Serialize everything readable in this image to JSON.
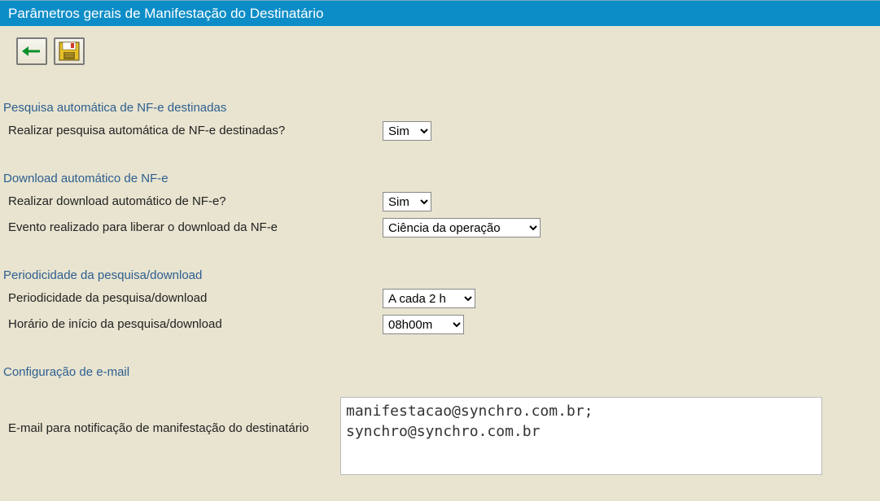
{
  "title": "Parâmetros gerais de Manifestação do Destinatário",
  "sections": {
    "pesquisa": {
      "title": "Pesquisa automática de NF-e destinadas",
      "realizar_label": "Realizar pesquisa automática de NF-e destinadas?",
      "realizar_value": "Sim"
    },
    "download": {
      "title": "Download automático de NF-e",
      "realizar_label": "Realizar download automático de NF-e?",
      "realizar_value": "Sim",
      "evento_label": "Evento realizado para liberar o download da NF-e",
      "evento_value": "Ciência da operação"
    },
    "periodicidade": {
      "title": "Periodicidade da pesquisa/download",
      "period_label": "Periodicidade da pesquisa/download",
      "period_value": "A cada 2 h",
      "horario_label": "Horário de início da pesquisa/download",
      "horario_value": "08h00m"
    },
    "email": {
      "title": "Configuração de e-mail",
      "label": "E-mail para notificação de manifestação do destinatário",
      "value": "manifestacao@synchro.com.br;\nsynchro@synchro.com.br"
    }
  }
}
